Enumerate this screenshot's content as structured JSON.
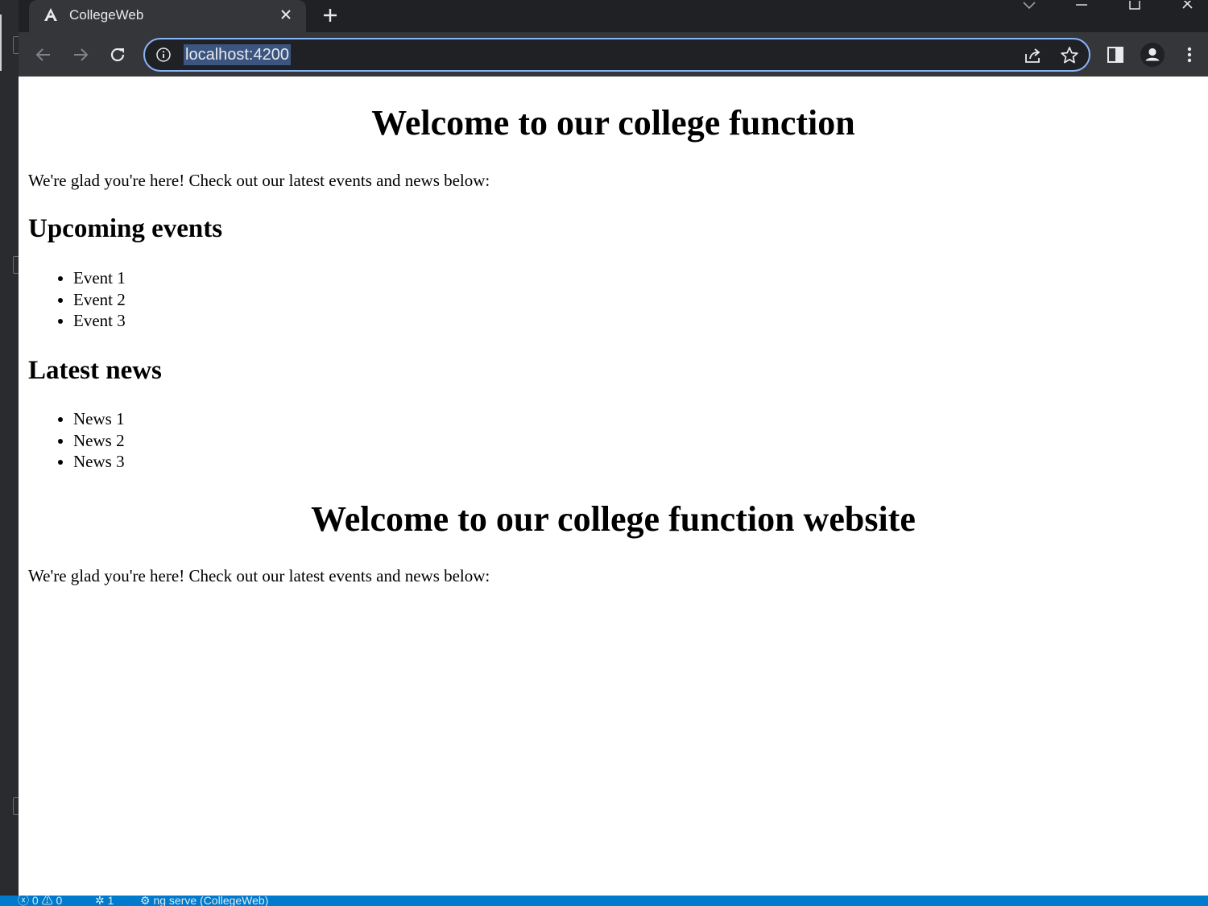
{
  "browser": {
    "tab": {
      "title": "CollegeWeb"
    },
    "address_bar": {
      "url": "localhost:4200"
    }
  },
  "page": {
    "heading_1": "Welcome to our college function",
    "intro_1": "We're glad you're here! Check out our latest events and news below:",
    "events": {
      "title": "Upcoming events",
      "items": [
        "Event 1",
        "Event 2",
        "Event 3"
      ]
    },
    "news": {
      "title": "Latest news",
      "items": [
        "News 1",
        "News 2",
        "News 3"
      ]
    },
    "heading_2": "Welcome to our college function website",
    "intro_2": "We're glad you're here! Check out our latest events and news below:"
  },
  "status_bar": {
    "errors": "0",
    "warnings": "0",
    "ports": "1",
    "task": "ng serve (CollegeWeb)"
  },
  "colors": {
    "chrome_bg": "#202124",
    "toolbar_bg": "#35363a",
    "omnibox_focus": "#8ab4f8",
    "url_selection": "#3b5580",
    "status_bar": "#007acc"
  }
}
